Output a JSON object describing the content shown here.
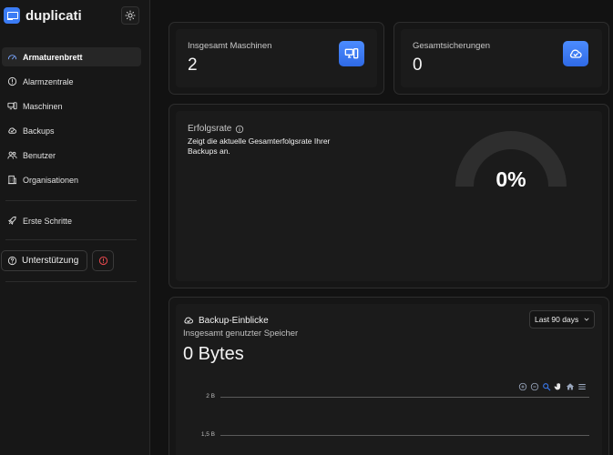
{
  "app": {
    "name": "duplicati"
  },
  "sidebar": {
    "items": [
      {
        "label": "Armaturenbrett",
        "icon": "dashboard-icon",
        "active": true
      },
      {
        "label": "Alarmzentrale",
        "icon": "alert-circle-icon"
      },
      {
        "label": "Maschinen",
        "icon": "machines-icon"
      },
      {
        "label": "Backups",
        "icon": "cloud-icon"
      },
      {
        "label": "Benutzer",
        "icon": "users-icon"
      },
      {
        "label": "Organisationen",
        "icon": "building-icon"
      }
    ],
    "getting_started": {
      "label": "Erste Schritte",
      "icon": "rocket-icon"
    },
    "support": {
      "label": "Unterstützung",
      "icon": "help-circle-icon"
    },
    "alert_icon": "alert-circle-icon"
  },
  "stats": {
    "machines": {
      "label": "Insgesamt Maschinen",
      "value": "2",
      "icon": "machines-icon"
    },
    "backups": {
      "label": "Gesamtsicherungen",
      "value": "0",
      "icon": "cloud-check-icon"
    }
  },
  "success_rate": {
    "title": "Erfolgsrate",
    "description": "Zeigt die aktuelle Gesamterfolgsrate Ihrer Backups an.",
    "value": "0%",
    "fraction": 0
  },
  "insights": {
    "title": "Backup-Einblicke",
    "subtitle": "Insgesamt genutzter Speicher",
    "total": "0 Bytes",
    "range": "Last 90 days",
    "y_ticks": [
      "2 B",
      "1,5 B"
    ]
  },
  "colors": {
    "accent": "#3b7cf5",
    "gauge_track": "#2e2e2e",
    "alert": "#e5484d"
  }
}
